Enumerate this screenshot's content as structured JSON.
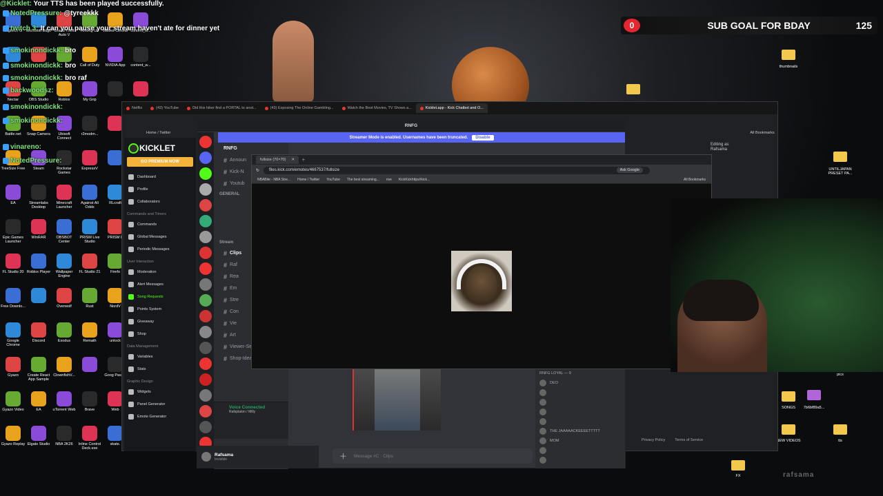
{
  "overlay": {
    "top_chat": {
      "user": "@Kicklet:",
      "text": "Your TTS has been played successfully."
    },
    "sub_goal": {
      "count": "0",
      "label": "SUB GOAL FOR BDAY",
      "target": "125"
    },
    "chat_lines": [
      {
        "user": "NotedPressure:",
        "text": "@tyreekkk"
      },
      {
        "user": "twitch 3:",
        "text": "It can you pause your stream haven't ate for dinner yet"
      },
      {
        "user": "smokinondickk:",
        "text": "bro"
      },
      {
        "user": "smokinondickk:",
        "text": "bro"
      },
      {
        "user": "smokinondickk:",
        "text": "bro raf"
      },
      {
        "user": "backwoodsz:",
        "text": ""
      },
      {
        "user": "smokinondickk:",
        "text": ""
      },
      {
        "user": "smokinondickk:",
        "text": ""
      },
      {
        "user": "vinareno:",
        "text": ""
      },
      {
        "user": "NotedPressure:",
        "text": ""
      }
    ],
    "bottom_text": "rafsama"
  },
  "desktop": {
    "icons_left": [
      [
        "Logitech G",
        "Microsoft Edge",
        "Grand Theft Auto V",
        "Among Us",
        "Waves Central",
        "content_w..."
      ],
      [
        "",
        "",
        "",
        "Call of Duty",
        "NVIDIA App",
        "content_w..."
      ],
      [
        "Nectar",
        "OBS Studio",
        "Roblox",
        "My Grip",
        "",
        ""
      ],
      [
        "Battle.net",
        "Snap Camera",
        "Ubisoft Connect",
        "r2modm...",
        "",
        ""
      ],
      [
        "TreeSize Free",
        "Steam",
        "Rockstar Games",
        "ExpressV",
        "",
        ""
      ],
      [
        "EA",
        "Streamlabs Desktop",
        "Minecraft Launcher",
        "Against All Odds",
        "RLcraft",
        ""
      ],
      [
        "Epic Games Launcher",
        "WinRAR",
        "OBSBOT Center",
        "PRISM Live Studio",
        "PRISM L",
        ""
      ],
      [
        "FL Studio 20",
        "Roblox Player",
        "Wallpaper Engine",
        "FL Studio 21",
        "Firefo",
        ""
      ],
      [
        "Free Downlo...",
        "",
        "Overwolf",
        "Rust",
        "NordV",
        ""
      ],
      [
        "Google Chrome",
        "Discord",
        "Exodus",
        "Remath",
        "unlock",
        ""
      ],
      [
        "Gyazo",
        "Create React App Sample",
        "ClownfishV...",
        "",
        "Goog Passw",
        ""
      ],
      [
        "Gyazo Video",
        "EA",
        "uTorrent Web",
        "Brave",
        "Web",
        ""
      ],
      [
        "Gyazo Replay",
        "Elgato Studio",
        "NBA 2K26",
        "Inline Control Deck.exe",
        "skate.",
        "content_w..."
      ]
    ],
    "icons_right": [
      "thumbnails",
      "UNTILJAPAN PRESET PA...",
      "SONGS",
      "7b6bf89a5...",
      "NEW VIDEOS",
      "tts",
      "FX",
      "pics"
    ]
  },
  "back_browser": {
    "tabs": [
      "Netflix",
      "(43) YouTube",
      "Did this hiker find a PORTAL to anot...",
      "(43) Exposing The Online Gambling...",
      "Watch the Best Movies, TV Shows a...",
      "Kicklet.app - Kick Chatbot and O..."
    ],
    "bookmark": "Home / Twitter",
    "all_bookmarks": "All Bookmarks",
    "editing_as": "Editing as",
    "editing_user": "Rafsama",
    "footer_links": [
      "Privacy Policy",
      "Terms of Service"
    ]
  },
  "kicklet": {
    "logo": "KICKLET",
    "premium": "GO PREMIUM NOW",
    "items_top": [
      "Dashboard",
      "Profile",
      "Collaborators"
    ],
    "section_commands": "Commands and Timers",
    "items_commands": [
      "Commands",
      "Global Messages",
      "Periodic Messages"
    ],
    "section_user": "User Interaction",
    "items_user": [
      "Moderation",
      "Alert Messages",
      "Song Requests",
      "Points System",
      "Giveaway",
      "Shop"
    ],
    "section_data": "Data Management",
    "items_data": [
      "Variables",
      "Stats"
    ],
    "section_graphic": "Graphic Design",
    "items_graphic": [
      "Widgets",
      "Panel Generator",
      "Emote Generator"
    ]
  },
  "discord": {
    "title": "RNFG",
    "streamer_mode": "Streamer Mode is enabled. Usernames have been truncated.",
    "disable": "Disable",
    "server_name": "RNFG",
    "search": "Search RNFG",
    "channel_header": "Clips",
    "category_general": "GENERAL",
    "category_stream": "Stream",
    "channels": [
      "Announ",
      "Kick-N",
      "Youtub"
    ],
    "stream_channels": [
      "Clips",
      "Raf",
      "Rea",
      "Em",
      "Stre",
      "Con",
      "Vie",
      "Art",
      "Viewer-Setups",
      "Shop-Ideas"
    ],
    "voice_status": "Voice Connected",
    "voice_location": "Rafsplaton / Milly",
    "user_name": "Rafsama",
    "user_status": "Invisible",
    "message_placeholder": "Message #C · Clips",
    "members_header": "RNFG LOYAL — 9",
    "members": [
      "DEO",
      "",
      "",
      "",
      "",
      "THE JAAAAACKEEEETTTTT",
      "MOM",
      "",
      ""
    ]
  },
  "popup": {
    "tab_title": "fullsize (70×70)",
    "url": "files.kick.com/emotes/4667537/fullsize",
    "ask_google": "Ask Google",
    "bookmarks": [
      "NBABite - NBA Stre...",
      "Home / Twitter",
      "YouTube",
      "The best streaming...",
      "rive",
      "KickKickhttps//kick..."
    ],
    "all_bookmarks": "All Bookmarks"
  }
}
